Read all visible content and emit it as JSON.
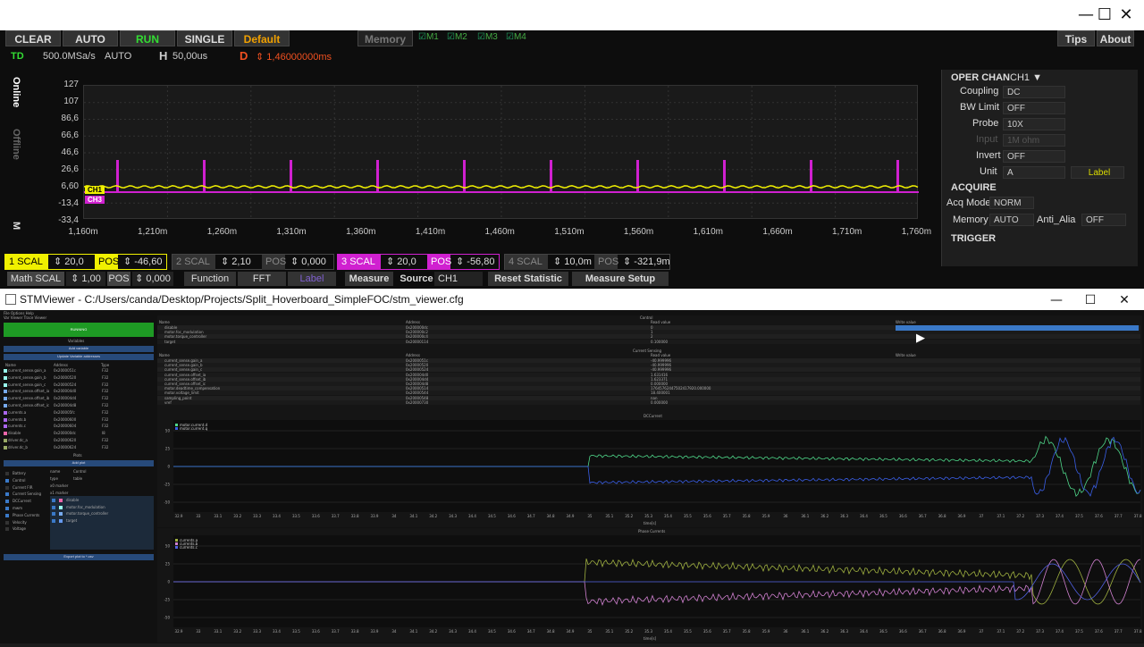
{
  "osc": {
    "buttons": [
      "CLEAR",
      "AUTO",
      "RUN",
      "SINGLE",
      "Default"
    ],
    "memory": "Memory",
    "mem_items": [
      "M1",
      "M2",
      "M3",
      "M4"
    ],
    "tips": "Tips",
    "about": "About",
    "td": "TD",
    "rate": "500.0MSa/s",
    "acq": "AUTO",
    "h_label": "H",
    "h_val": "50,00us",
    "d_label": "D",
    "d_val": "1,46000000ms",
    "yticks": [
      "127",
      "107",
      "86,6",
      "66,6",
      "46,6",
      "26,6",
      "6,60",
      "-13,4",
      "-33,4"
    ],
    "xticks": [
      "1,160m",
      "1,210m",
      "1,260m",
      "1,310m",
      "1,360m",
      "1,410m",
      "1,460m",
      "1,510m",
      "1,560m",
      "1,610m",
      "1,660m",
      "1,710m",
      "1,760m"
    ],
    "tabs": {
      "online": "Online",
      "offline": "Offline",
      "m": "M"
    },
    "ch1_marker": "CH1",
    "ch3_marker": "CH3",
    "panel": {
      "oper": "OPER CHAN",
      "oper_val": "CH1",
      "coupling": "Coupling",
      "coupling_val": "DC",
      "bw": "BW Limit",
      "bw_val": "OFF",
      "probe": "Probe",
      "probe_val": "10X",
      "input": "Input",
      "input_val": "1M ohm",
      "invert": "Invert",
      "invert_val": "OFF",
      "unit": "Unit",
      "unit_val": "A",
      "label_btn": "Label",
      "acquire": "ACQUIRE",
      "acqmode": "Acq Mode",
      "acqmode_val": "NORM",
      "memory": "Memory",
      "memory_val": "AUTO",
      "antialias": "Anti_Alia",
      "antialias_val": "OFF",
      "trigger": "TRIGGER"
    },
    "ch": [
      {
        "n": "1",
        "scal": "SCAL",
        "sv": "20,0",
        "pos": "POS",
        "pv": "-46,60"
      },
      {
        "n": "2",
        "scal": "SCAL",
        "sv": "2,10",
        "pos": "POS",
        "pv": "0,000"
      },
      {
        "n": "3",
        "scal": "SCAL",
        "sv": "20,0",
        "pos": "POS",
        "pv": "-56,80"
      },
      {
        "n": "4",
        "scal": "SCAL",
        "sv": "10,0m",
        "pos": "POS",
        "pv": "-321,9m"
      }
    ],
    "math": "Math SCAL",
    "math_val": "1,00",
    "math_pos": "POS",
    "math_pos_val": "0,000",
    "function": "Function",
    "fft": "FFT",
    "label": "Label",
    "measure": "Measure",
    "source": "Source",
    "source_val": "CH1",
    "reset": "Reset Statistic",
    "setup": "Measure Setup",
    "colors": {
      "ch1": "#f0f000",
      "ch3": "#d020d0"
    }
  },
  "stm": {
    "title": "STMViewer - C:/Users/canda/Desktop/Projects/Split_Hoverboard_SimpleFOC/stm_viewer.cfg",
    "menu": "File  Options  Help",
    "tabs": "Var Viewer  Trace Viewer",
    "running": "RUNNING",
    "variables": "Variables",
    "add_var": "Add variable",
    "update_addr": "Update Variable addresses",
    "var_cols": [
      "Name",
      "Address",
      "Type"
    ],
    "vars": [
      [
        "current_sense.gain_a",
        "0x2000051c",
        "F32"
      ],
      [
        "current_sense.gain_b",
        "0x20000520",
        "F32"
      ],
      [
        "current_sense.gain_c",
        "0x20000524",
        "F32"
      ],
      [
        "current_sense.offset_ia",
        "0x200004d0",
        "F32"
      ],
      [
        "current_sense.offset_ib",
        "0x200004d4",
        "F32"
      ],
      [
        "current_sense.offset_ic",
        "0x200004d8",
        "F32"
      ],
      [
        "currents.a",
        "0x200005fc",
        "F32"
      ],
      [
        "currents.b",
        "0x20000600",
        "F32"
      ],
      [
        "currents.c",
        "0x20000604",
        "F32"
      ],
      [
        "disable",
        "0x200000dc",
        "I8"
      ],
      [
        "driver.dc_a",
        "0x20000620",
        "F32"
      ],
      [
        "driver.dc_b",
        "0x20000624",
        "F32"
      ]
    ],
    "plots": "Plots",
    "add_plot": "Add plot",
    "plot_list": [
      "Battery",
      "Control",
      "Current FIR",
      "Current Sensing",
      "DCCurrent",
      "mwm",
      "Phase Currents",
      "Velocity",
      "Voltage"
    ],
    "plot_props": {
      "name": "name",
      "name_val": "Control",
      "type": "type",
      "type_val": "table",
      "x0": "x0 marker",
      "x1": "x1 marker"
    },
    "plot_vars": [
      "disable",
      "motor.foc_modulation",
      "motor.torque_controller",
      "target"
    ],
    "export": "Export plot to *.csv",
    "control_title": "Control",
    "table_cols": [
      "Name",
      "Address",
      "Read value",
      "Write value"
    ],
    "control_rows": [
      [
        "disable",
        "0x200000dc",
        "0",
        ""
      ],
      [
        "motor.foc_modulation",
        "0x200000c2",
        "1",
        ""
      ],
      [
        "motor.torque_controller",
        "0x200000c4",
        "2",
        ""
      ],
      [
        "target",
        "0x20000114",
        "0.100000",
        ""
      ]
    ],
    "cs_title": "Current Sensing",
    "cs_rows": [
      [
        "current_sense.gain_a",
        "0x2000051c",
        "-40.999996"
      ],
      [
        "current_sense.gain_b",
        "0x20000520",
        "-40.999996"
      ],
      [
        "current_sense.gain_c",
        "0x20000524",
        "-40.999996"
      ],
      [
        "current_sense.offset_ia",
        "0x200004d0",
        "1.631416"
      ],
      [
        "current_sense.offset_ib",
        "0x200004d4",
        "1.623371"
      ],
      [
        "current_sense.offset_ic",
        "0x200004d8",
        "0.000000"
      ],
      [
        "motor.deadtime_compensation",
        "0x20000514",
        "17645762447502417920.000000"
      ],
      [
        "motor.voltage_limit",
        "0x20000544",
        "18.400001"
      ],
      [
        "sampling_point",
        "0x20000548",
        "nan"
      ],
      [
        "vref",
        "0x20000730",
        "0.000000"
      ]
    ],
    "dc_title": "DCCurrent",
    "dc_legend": [
      "motor.current.d",
      "motor.current.q"
    ],
    "pc_title": "Phase Currents",
    "pc_legend": [
      "currents.a",
      "currents.b",
      "currents.c"
    ],
    "x_axis": "time[s]",
    "xticks": [
      "32.9",
      "33",
      "33.1",
      "33.2",
      "33.3",
      "33.4",
      "33.5",
      "33.6",
      "33.7",
      "33.8",
      "33.9",
      "34",
      "34.1",
      "34.2",
      "34.3",
      "34.4",
      "34.5",
      "34.6",
      "34.7",
      "34.8",
      "34.9",
      "35",
      "35.1",
      "35.2",
      "35.3",
      "35.4",
      "35.5",
      "35.6",
      "35.7",
      "35.8",
      "35.9",
      "36",
      "36.1",
      "36.2",
      "36.3",
      "36.4",
      "36.5",
      "36.6",
      "36.7",
      "36.8",
      "36.9",
      "37",
      "37.1",
      "37.2",
      "37.3",
      "37.4",
      "37.5",
      "37.6",
      "37.7",
      "37.8"
    ],
    "dc_yticks": [
      "50",
      "25",
      "0",
      "-25",
      "-50"
    ],
    "pc_yticks": [
      "50",
      "25",
      "0",
      "-25",
      "-50"
    ]
  }
}
